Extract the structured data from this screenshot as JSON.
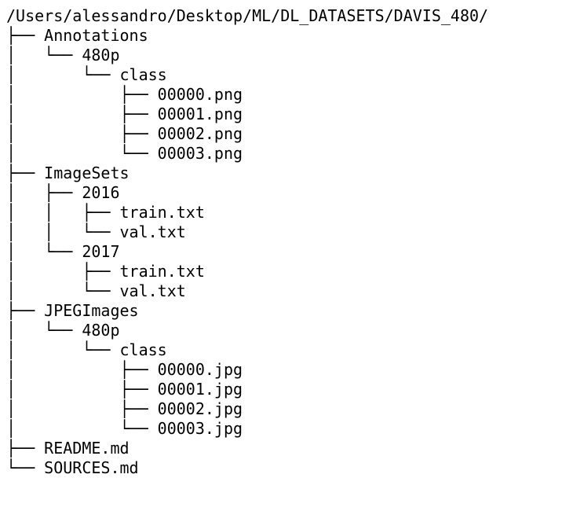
{
  "tree": {
    "root": "/Users/alessandro/Desktop/ML/DL_DATASETS/DAVIS_480/",
    "children": [
      {
        "name": "Annotations",
        "children": [
          {
            "name": "480p",
            "children": [
              {
                "name": "class",
                "children": [
                  {
                    "name": "00000.png"
                  },
                  {
                    "name": "00001.png"
                  },
                  {
                    "name": "00002.png"
                  },
                  {
                    "name": "00003.png"
                  }
                ]
              }
            ]
          }
        ]
      },
      {
        "name": "ImageSets",
        "children": [
          {
            "name": "2016",
            "children": [
              {
                "name": "train.txt"
              },
              {
                "name": "val.txt"
              }
            ]
          },
          {
            "name": "2017",
            "children": [
              {
                "name": "train.txt"
              },
              {
                "name": "val.txt"
              }
            ]
          }
        ]
      },
      {
        "name": "JPEGImages",
        "children": [
          {
            "name": "480p",
            "children": [
              {
                "name": "class",
                "children": [
                  {
                    "name": "00000.jpg"
                  },
                  {
                    "name": "00001.jpg"
                  },
                  {
                    "name": "00002.jpg"
                  },
                  {
                    "name": "00003.jpg"
                  }
                ]
              }
            ]
          }
        ]
      },
      {
        "name": "README.md"
      },
      {
        "name": "SOURCES.md"
      }
    ]
  },
  "glyphs": {
    "tee": "├── ",
    "elbow": "└── ",
    "pipe": "│   ",
    "blank": "    "
  }
}
